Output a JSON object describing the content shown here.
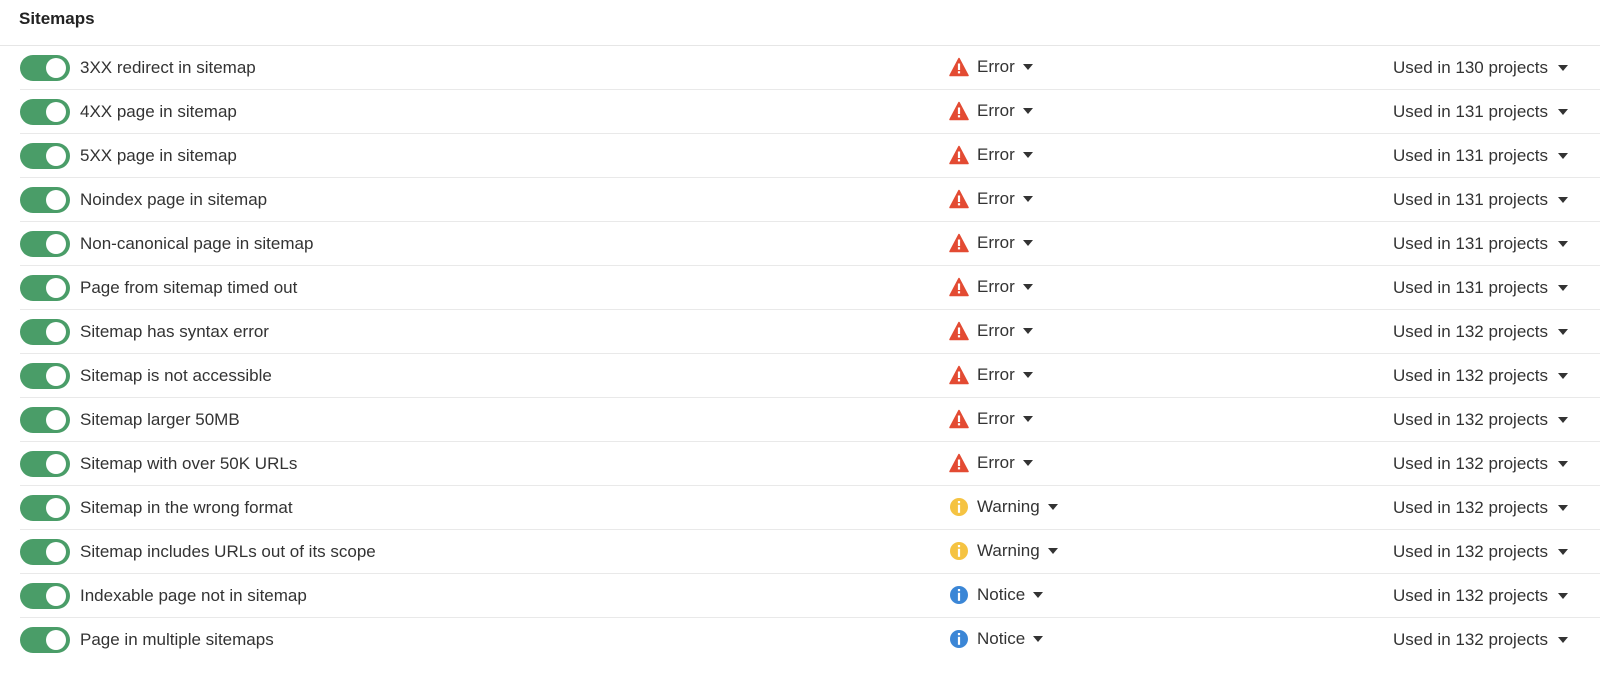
{
  "section": {
    "title": "Sitemaps"
  },
  "severity_colors": {
    "Error": "#e34b33",
    "Warning": "#f5c342",
    "Notice": "#3b86d6"
  },
  "toggle_color": "#4a9d68",
  "rows": [
    {
      "label": "3XX redirect in sitemap",
      "enabled": true,
      "severity": "Error",
      "usage": "Used in 130 projects"
    },
    {
      "label": "4XX page in sitemap",
      "enabled": true,
      "severity": "Error",
      "usage": "Used in 131 projects"
    },
    {
      "label": "5XX page in sitemap",
      "enabled": true,
      "severity": "Error",
      "usage": "Used in 131 projects"
    },
    {
      "label": "Noindex page in sitemap",
      "enabled": true,
      "severity": "Error",
      "usage": "Used in 131 projects"
    },
    {
      "label": "Non-canonical page in sitemap",
      "enabled": true,
      "severity": "Error",
      "usage": "Used in 131 projects"
    },
    {
      "label": "Page from sitemap timed out",
      "enabled": true,
      "severity": "Error",
      "usage": "Used in 131 projects"
    },
    {
      "label": "Sitemap has syntax error",
      "enabled": true,
      "severity": "Error",
      "usage": "Used in 132 projects"
    },
    {
      "label": "Sitemap is not accessible",
      "enabled": true,
      "severity": "Error",
      "usage": "Used in 132 projects"
    },
    {
      "label": "Sitemap larger 50MB",
      "enabled": true,
      "severity": "Error",
      "usage": "Used in 132 projects"
    },
    {
      "label": "Sitemap with over 50K URLs",
      "enabled": true,
      "severity": "Error",
      "usage": "Used in 132 projects"
    },
    {
      "label": "Sitemap in the wrong format",
      "enabled": true,
      "severity": "Warning",
      "usage": "Used in 132 projects"
    },
    {
      "label": "Sitemap includes URLs out of its scope",
      "enabled": true,
      "severity": "Warning",
      "usage": "Used in 132 projects"
    },
    {
      "label": "Indexable page not in sitemap",
      "enabled": true,
      "severity": "Notice",
      "usage": "Used in 132 projects"
    },
    {
      "label": "Page in multiple sitemaps",
      "enabled": true,
      "severity": "Notice",
      "usage": "Used in 132 projects"
    }
  ]
}
